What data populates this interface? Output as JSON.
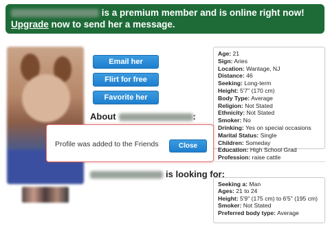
{
  "banner": {
    "text_main": "is a premium member and is online right now!",
    "upgrade_link": "Upgrade",
    "text_rest": "now to send her a message."
  },
  "actions": {
    "email": "Email her",
    "flirt": "Flirt for free",
    "favorite": "Favorite her"
  },
  "about": {
    "label": "About",
    "suffix": ":"
  },
  "profile": [
    {
      "label": "Age:",
      "value": "21"
    },
    {
      "label": "Sign:",
      "value": "Aries"
    },
    {
      "label": "Location:",
      "value": "Wantage, NJ"
    },
    {
      "label": "Distance:",
      "value": "46"
    },
    {
      "label": "Seeking:",
      "value": "Long-term"
    },
    {
      "label": "Height:",
      "value": "5'7\" (170 cm)"
    },
    {
      "label": "Body Type:",
      "value": "Average"
    },
    {
      "label": "Religion:",
      "value": "Not Stated"
    },
    {
      "label": "Ethnicity:",
      "value": "Not Stated"
    },
    {
      "label": "Smoker:",
      "value": "No"
    },
    {
      "label": "Drinking:",
      "value": "Yes on special occasions"
    },
    {
      "label": "Marital Status:",
      "value": "Single"
    },
    {
      "label": "Children:",
      "value": "Someday"
    },
    {
      "label": "Education:",
      "value": "High School Grad"
    },
    {
      "label": "Profession:",
      "value": "raise cattle"
    }
  ],
  "modal": {
    "message": "Profile was added to the Friends",
    "close_label": "Close"
  },
  "looking": {
    "label": "is looking for:"
  },
  "seeking": [
    {
      "label": "Seeking a:",
      "value": "Man"
    },
    {
      "label": "Ages:",
      "value": "21 to 24"
    },
    {
      "label": "Height:",
      "value": "5'9\" (175 cm) to 6'5\" (195 cm)"
    },
    {
      "label": "Smoker:",
      "value": "Not Stated"
    },
    {
      "label": "Preferred body type:",
      "value": "Average"
    }
  ],
  "colors": {
    "banner_bg": "#1e6b38",
    "button_blue": "#1f7fcf",
    "modal_border": "#e07070"
  }
}
